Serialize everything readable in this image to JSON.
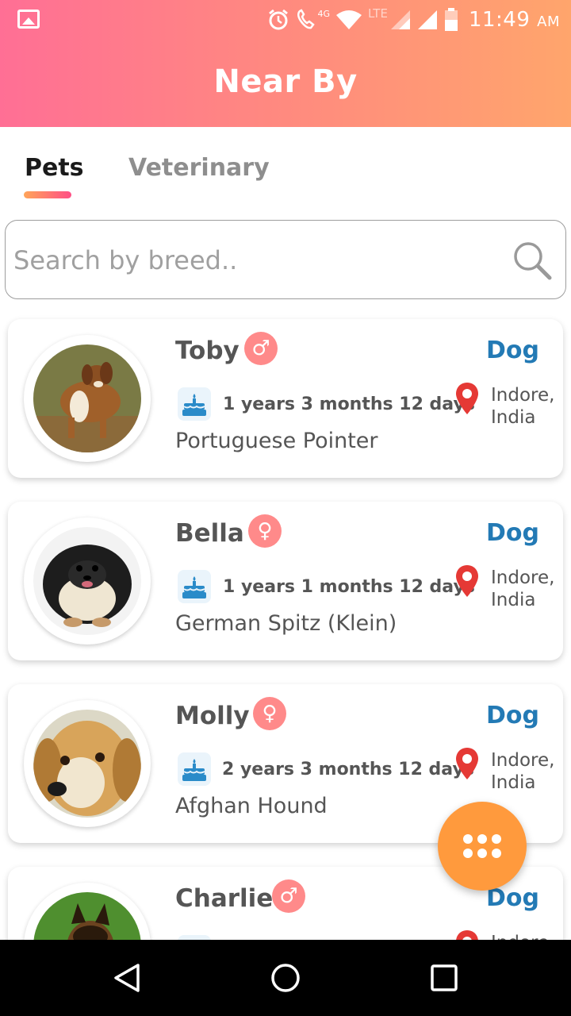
{
  "status_bar": {
    "time": "11:49",
    "ampm": "AM",
    "network_label": "LTE",
    "mobile_data_label": "4G",
    "icons": [
      "gallery-icon",
      "alarm-icon",
      "wifi-call-icon",
      "wifi-icon",
      "signal-icon",
      "battery-icon"
    ]
  },
  "header": {
    "title": "Near By",
    "gradient_start": "#ff6f95",
    "gradient_end": "#ffa56c"
  },
  "tabs": [
    {
      "label": "Pets",
      "active": true
    },
    {
      "label": "Veterinary",
      "active": false
    }
  ],
  "search": {
    "placeholder": "Search by breed..",
    "value": ""
  },
  "pets": [
    {
      "name": "Toby",
      "gender_symbol": "♂",
      "type": "Dog",
      "age": "1 years 3 months 12 days",
      "breed": "Portuguese Pointer",
      "location": "Indore, India"
    },
    {
      "name": "Bella",
      "gender_symbol": "♀",
      "type": "Dog",
      "age": "1 years 1 months 12 days",
      "breed": "German Spitz (Klein)",
      "location": "Indore, India"
    },
    {
      "name": "Molly",
      "gender_symbol": "♀",
      "type": "Dog",
      "age": "2 years 3 months 12 days",
      "breed": "Afghan Hound",
      "location": "Indore, India"
    },
    {
      "name": "Charlie",
      "gender_symbol": "♂",
      "type": "Dog",
      "age": "",
      "breed": "",
      "location": "Indore"
    }
  ],
  "fab": {
    "icon": "grid-menu-icon",
    "color": "#ff9a3d"
  },
  "colors": {
    "accent_blue": "#237ab5",
    "gender_badge": "#ff8a8a",
    "pin_red": "#e53935"
  },
  "nav_bar": {
    "icons": [
      "back-icon",
      "home-icon",
      "recent-apps-icon"
    ]
  }
}
